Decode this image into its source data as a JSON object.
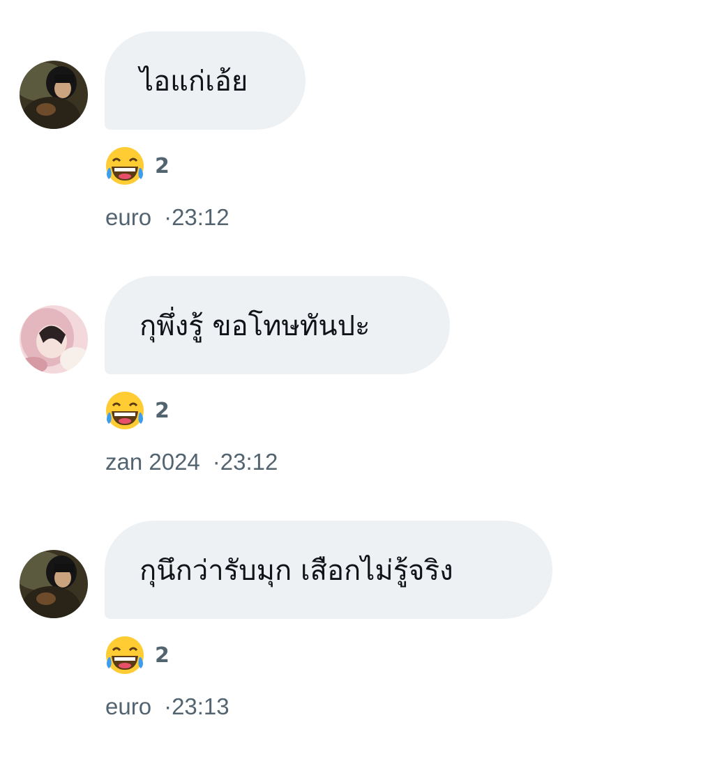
{
  "messages": [
    {
      "avatar": "user-avatar-dark-photo",
      "text": "ไอแก่เอ้ย",
      "reaction": {
        "emoji": "face-with-tears-of-joy-icon",
        "count": "2"
      },
      "sender": "euro",
      "separator": "·",
      "time": "23:12"
    },
    {
      "avatar": "user-avatar-pink-hood-photo",
      "text": "กุพึ่งรู้ ขอโทษทันปะ",
      "reaction": {
        "emoji": "face-with-tears-of-joy-icon",
        "count": "2"
      },
      "sender": "zan 2024",
      "separator": "·",
      "time": "23:12"
    },
    {
      "avatar": "user-avatar-dark-photo",
      "text": "กุนึกว่ารับมุก เสือกไม่รู้จริง",
      "reaction": {
        "emoji": "face-with-tears-of-joy-icon",
        "count": "2"
      },
      "sender": "euro",
      "separator": "·",
      "time": "23:13"
    }
  ],
  "colors": {
    "bubble": "#eef1f3",
    "text": "#101418",
    "meta": "#536471",
    "emoji_face": "#ffcc33",
    "emoji_tears": "#3b9cf0"
  }
}
